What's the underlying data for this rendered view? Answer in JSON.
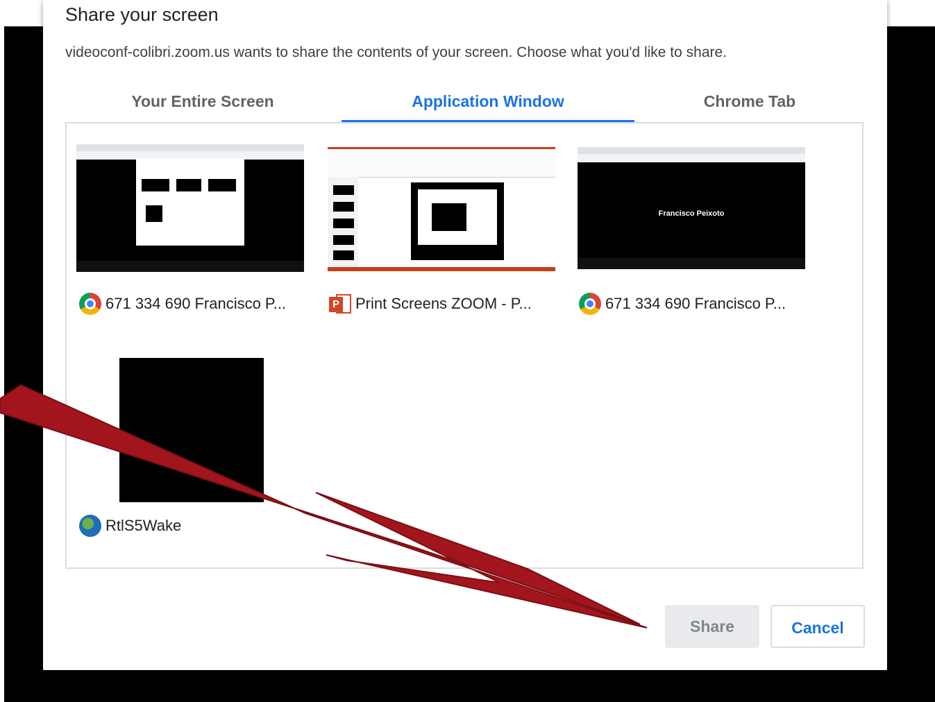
{
  "dialog": {
    "title": "Share your screen",
    "subtitle": "videoconf-colibri.zoom.us wants to share the contents of your screen. Choose what you'd like to share."
  },
  "tabs": [
    {
      "label": "Your Entire Screen",
      "active": false
    },
    {
      "label": "Application Window",
      "active": true
    },
    {
      "label": "Chrome Tab",
      "active": false
    }
  ],
  "windows": [
    {
      "label": "671 334 690 Francisco P...",
      "icon": "chrome-icon"
    },
    {
      "label": "Print Screens ZOOM - P...",
      "icon": "powerpoint-icon"
    },
    {
      "label": "671 334 690 Francisco P...",
      "icon": "chrome-icon",
      "thumb_text": "Francisco Peixoto"
    },
    {
      "label": "RtlS5Wake",
      "icon": "globe-icon"
    }
  ],
  "buttons": {
    "share": "Share",
    "cancel": "Cancel"
  },
  "colors": {
    "accent": "#1a73e8",
    "arrow": "#a3151c"
  }
}
